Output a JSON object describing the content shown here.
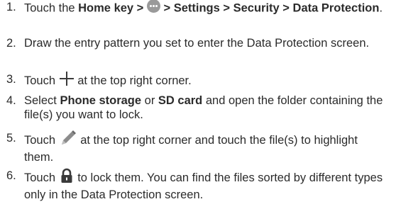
{
  "steps": [
    {
      "num": "1.",
      "pre": "Touch the ",
      "home": "Home",
      "mid": " key > ",
      "apps_icon": "apps-grid-icon",
      "path": " > Settings > Security > Data Protection",
      "end": "."
    },
    {
      "num": "2.",
      "text": "Draw the entry pattern you set to enter the Data Protection screen."
    },
    {
      "num": "3.",
      "pre": "Touch ",
      "icon": "plus-icon",
      "post": " at the top right corner."
    },
    {
      "num": "4.",
      "pre": "Select ",
      "b1": "Phone storage",
      "mid": " or ",
      "b2": "SD card",
      "post": " and open the folder containing the file(s) you want to lock."
    },
    {
      "num": "5.",
      "pre": "Touch ",
      "icon": "pencil-icon",
      "post": " at the top right corner and touch the file(s) to highlight them."
    },
    {
      "num": "6.",
      "pre": "Touch ",
      "icon": "lock-icon",
      "post": " to lock them. You can find the files sorted by different types only in the Data Protection screen."
    }
  ],
  "colors": {
    "text": "#2b2b2b",
    "icon_gray": "#9a9a9a",
    "icon_dark": "#3a3a3a"
  }
}
